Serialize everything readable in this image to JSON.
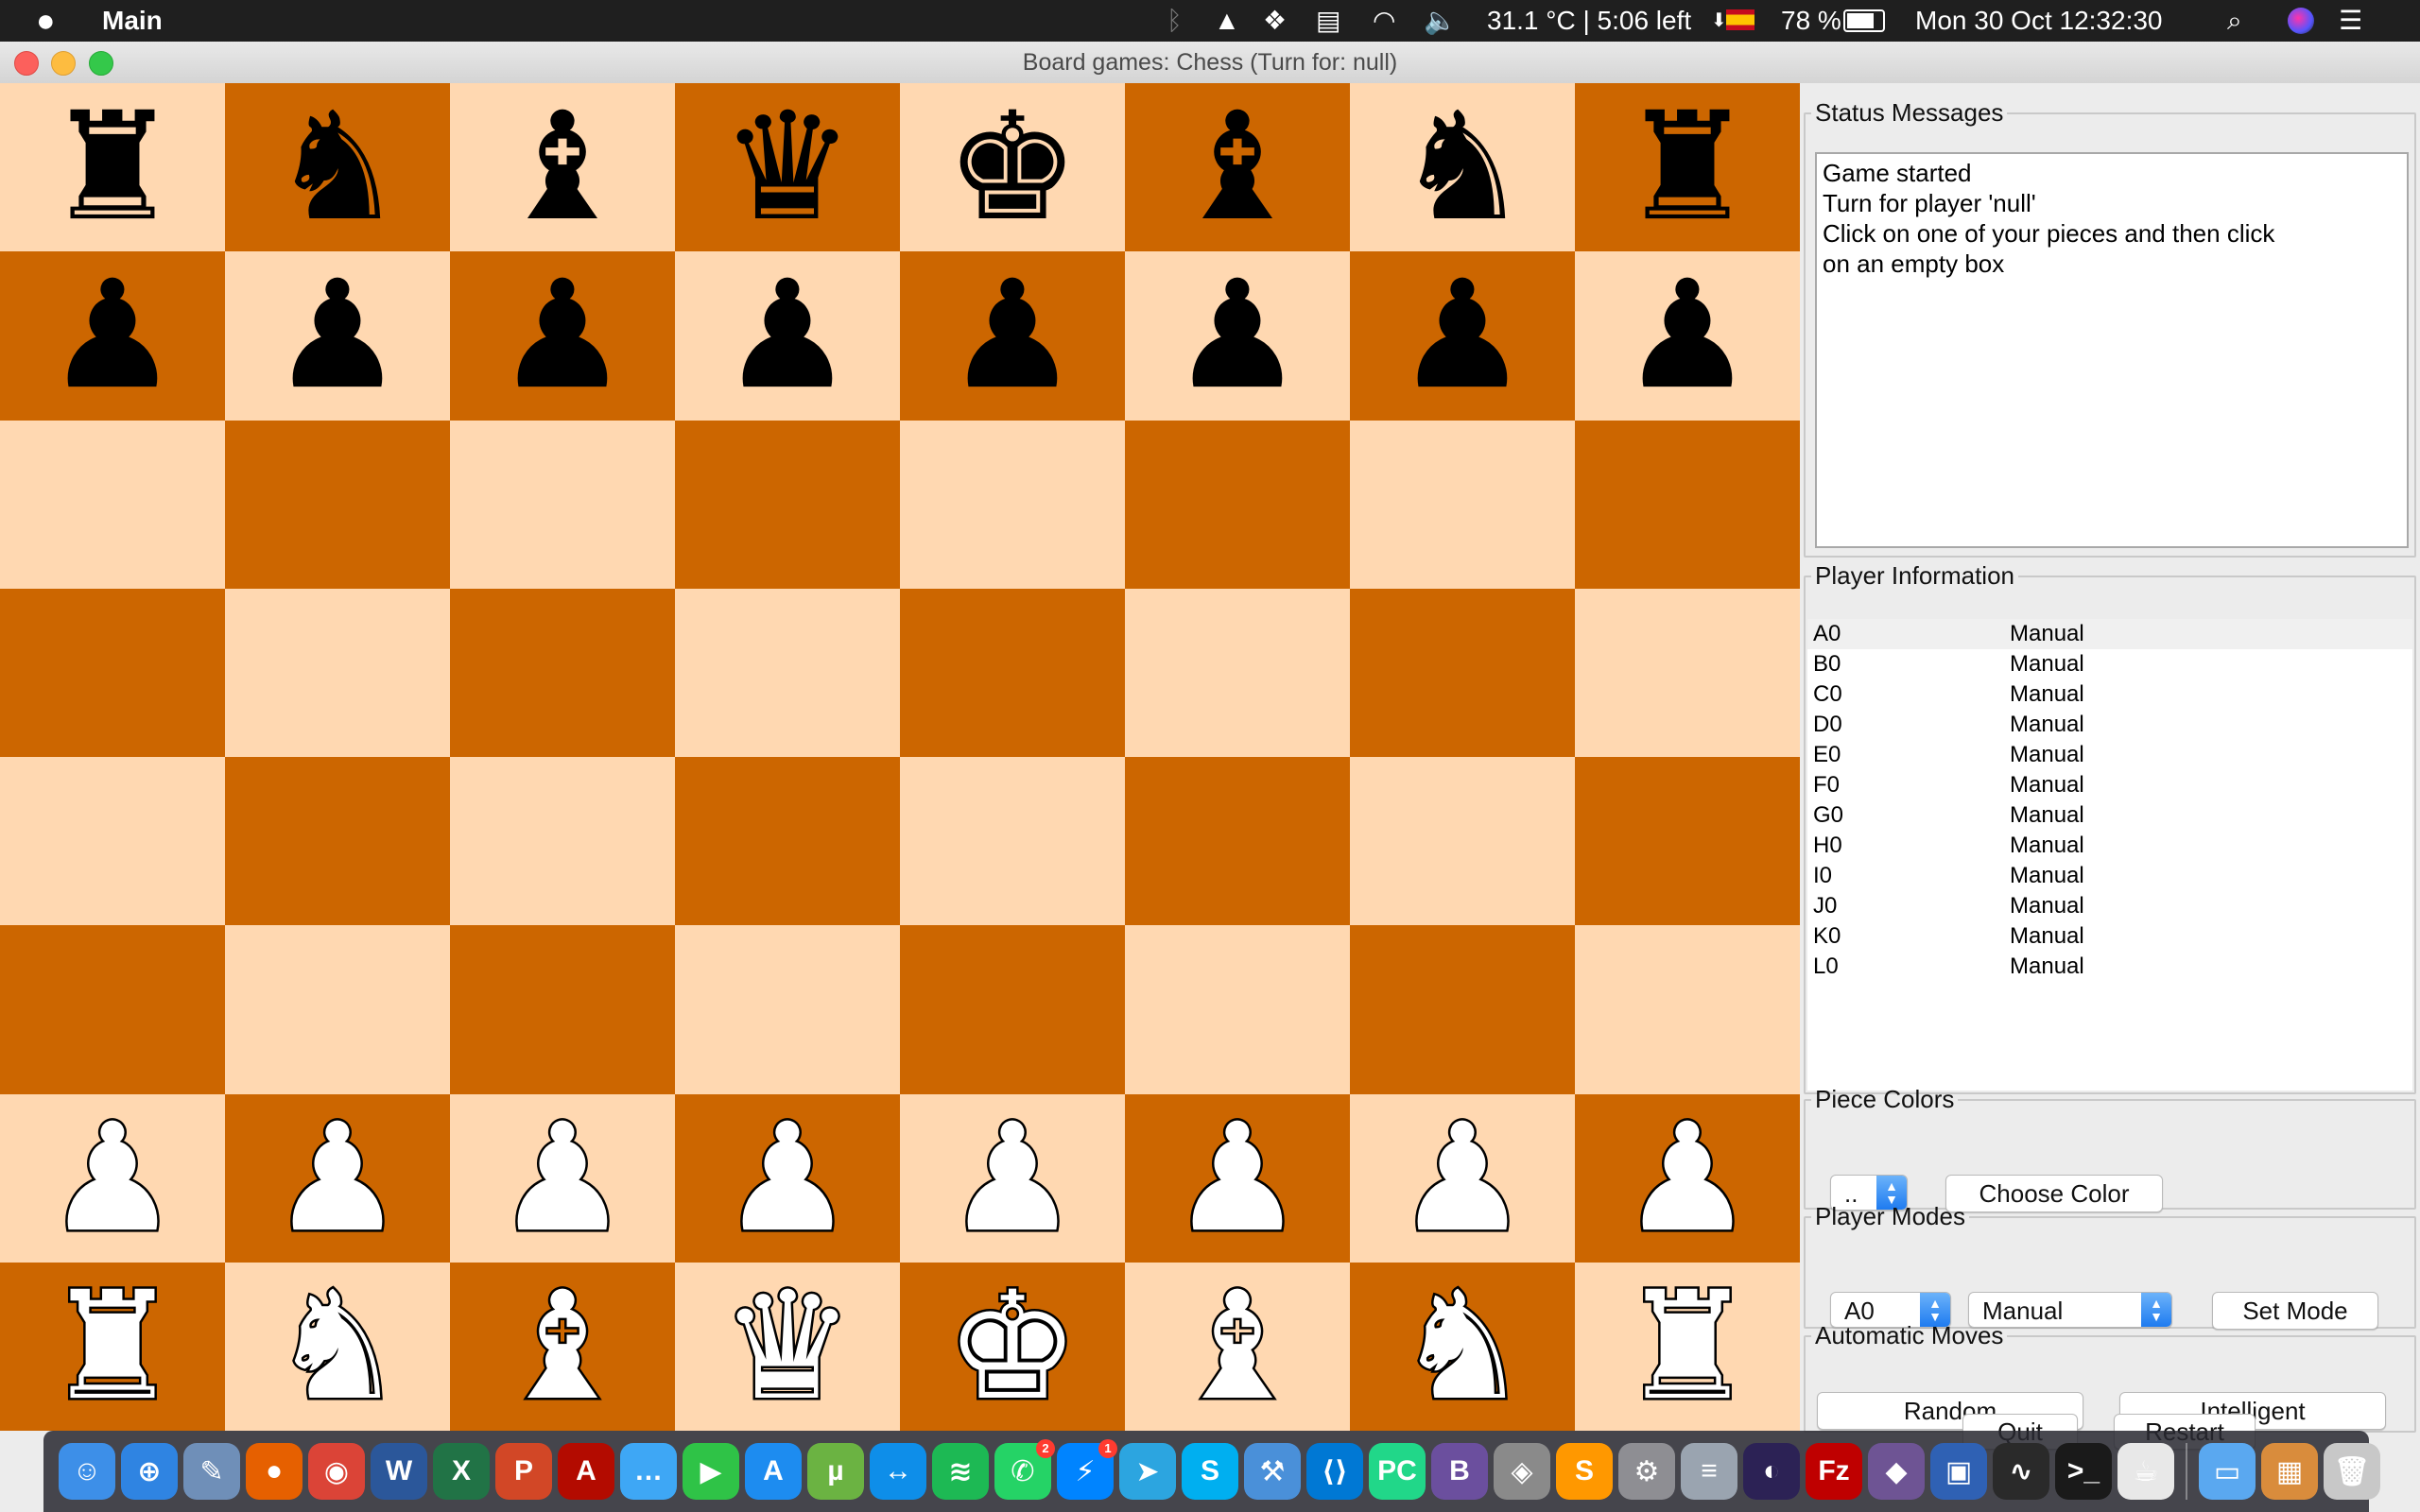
{
  "menubar": {
    "app_name": "Main",
    "temperature_battery": "31.1 °C | 5:06 left",
    "battery_percent": "78 %",
    "datetime": "Mon 30 Oct  12:32:30"
  },
  "window": {
    "title": "Board games: Chess (Turn for: null)"
  },
  "board": {
    "rows": [
      [
        "♜",
        "♞",
        "♝",
        "♛",
        "♚",
        "♝",
        "♞",
        "♜"
      ],
      [
        "♟",
        "♟",
        "♟",
        "♟",
        "♟",
        "♟",
        "♟",
        "♟"
      ],
      [
        "",
        "",
        "",
        "",
        "",
        "",
        "",
        ""
      ],
      [
        "",
        "",
        "",
        "",
        "",
        "",
        "",
        ""
      ],
      [
        "",
        "",
        "",
        "",
        "",
        "",
        "",
        ""
      ],
      [
        "",
        "",
        "",
        "",
        "",
        "",
        "",
        ""
      ],
      [
        "♟",
        "♟",
        "♟",
        "♟",
        "♟",
        "♟",
        "♟",
        "♟"
      ],
      [
        "♜",
        "♞",
        "♝",
        "♛",
        "♚",
        "♝",
        "♞",
        "♜"
      ]
    ],
    "piece_colors": [
      "black",
      "black",
      "empty",
      "empty",
      "empty",
      "empty",
      "white",
      "white"
    ],
    "light_color": "#ffd8b1",
    "dark_color": "#cc6600"
  },
  "status": {
    "legend": "Status Messages",
    "lines": [
      "Game started",
      "Turn for player 'null'",
      "Click on one of your pieces and then click",
      "on an empty box"
    ]
  },
  "players": {
    "legend": "Player Information",
    "rows": [
      {
        "id": "A0",
        "mode": "Manual"
      },
      {
        "id": "B0",
        "mode": "Manual"
      },
      {
        "id": "C0",
        "mode": "Manual"
      },
      {
        "id": "D0",
        "mode": "Manual"
      },
      {
        "id": "E0",
        "mode": "Manual"
      },
      {
        "id": "F0",
        "mode": "Manual"
      },
      {
        "id": "G0",
        "mode": "Manual"
      },
      {
        "id": "H0",
        "mode": "Manual"
      },
      {
        "id": "I0",
        "mode": "Manual"
      },
      {
        "id": "J0",
        "mode": "Manual"
      },
      {
        "id": "K0",
        "mode": "Manual"
      },
      {
        "id": "L0",
        "mode": "Manual"
      }
    ]
  },
  "piece_colors": {
    "legend": "Piece Colors",
    "selected": "..",
    "choose_button": "Choose Color"
  },
  "player_modes": {
    "legend": "Player Modes",
    "player_selected": "A0",
    "mode_selected": "Manual",
    "set_button": "Set Mode"
  },
  "automatic_moves": {
    "legend": "Automatic Moves",
    "random_button": "Random",
    "intelligent_button": "Intelligent"
  },
  "footer": {
    "quit_button": "Quit",
    "restart_button": "Restart"
  },
  "dock": {
    "items": [
      {
        "name": "finder-icon",
        "color": "#3d8fe8",
        "glyph": "☺"
      },
      {
        "name": "safari-icon",
        "color": "#2f84e2",
        "glyph": "⊕"
      },
      {
        "name": "preview-icon",
        "color": "#6f8fb8",
        "glyph": "✎"
      },
      {
        "name": "firefox-icon",
        "color": "#e66000",
        "glyph": "●"
      },
      {
        "name": "chrome-icon",
        "color": "#db4437",
        "glyph": "◉"
      },
      {
        "name": "word-icon",
        "color": "#2b579a",
        "glyph": "W"
      },
      {
        "name": "excel-icon",
        "color": "#217346",
        "glyph": "X"
      },
      {
        "name": "powerpoint-icon",
        "color": "#d24726",
        "glyph": "P"
      },
      {
        "name": "acrobat-icon",
        "color": "#b30b00",
        "glyph": "A"
      },
      {
        "name": "messages-icon",
        "color": "#3ea7f5",
        "glyph": "…"
      },
      {
        "name": "facetime-icon",
        "color": "#2fc347",
        "glyph": "▶"
      },
      {
        "name": "app-store-icon",
        "color": "#1d8cf0",
        "glyph": "A"
      },
      {
        "name": "utorrent-icon",
        "color": "#6bb342",
        "glyph": "µ"
      },
      {
        "name": "teamviewer-icon",
        "color": "#0e8ee9",
        "glyph": "↔"
      },
      {
        "name": "spotify-icon",
        "color": "#1db954",
        "glyph": "≋"
      },
      {
        "name": "whatsapp-icon",
        "color": "#25d366",
        "glyph": "✆",
        "badge": "2"
      },
      {
        "name": "messenger-icon",
        "color": "#0084ff",
        "glyph": "⚡",
        "badge": "1"
      },
      {
        "name": "telegram-icon",
        "color": "#2ca5e0",
        "glyph": "➤"
      },
      {
        "name": "skype-icon",
        "color": "#00aff0",
        "glyph": "S"
      },
      {
        "name": "xcode-icon",
        "color": "#4a90d9",
        "glyph": "⚒"
      },
      {
        "name": "vscode-icon",
        "color": "#0078d4",
        "glyph": "⟨⟩"
      },
      {
        "name": "pycharm-icon",
        "color": "#21d789",
        "glyph": "PC"
      },
      {
        "name": "bbedit-icon",
        "color": "#6b4f9e",
        "glyph": "B"
      },
      {
        "name": "eagle-icon",
        "color": "#8a8a8a",
        "glyph": "◈"
      },
      {
        "name": "sublime-icon",
        "color": "#ff9800",
        "glyph": "S"
      },
      {
        "name": "system-preferences-icon",
        "color": "#8e8e93",
        "glyph": "⚙"
      },
      {
        "name": "database-icon",
        "color": "#9aa4b0",
        "glyph": "≡"
      },
      {
        "name": "eclipse-icon",
        "color": "#2c2255",
        "glyph": "◐"
      },
      {
        "name": "filezilla-icon",
        "color": "#bf0000",
        "glyph": "Fz"
      },
      {
        "name": "github-icon",
        "color": "#6e5494",
        "glyph": "◆"
      },
      {
        "name": "virtualbox-icon",
        "color": "#2f61b4",
        "glyph": "▣"
      },
      {
        "name": "activity-monitor-icon",
        "color": "#2a2a2a",
        "glyph": "∿"
      },
      {
        "name": "terminal-icon",
        "color": "#1a1a1a",
        "glyph": ">_"
      },
      {
        "name": "java-icon",
        "color": "#e8e8e8",
        "glyph": "☕"
      },
      {
        "name": "separator",
        "color": "",
        "glyph": ""
      },
      {
        "name": "folder-icon",
        "color": "#5aa8f0",
        "glyph": "▭"
      },
      {
        "name": "chess-board-icon",
        "color": "#d98c3c",
        "glyph": "▦"
      },
      {
        "name": "trash-icon",
        "color": "#c8c8c8",
        "glyph": "🗑"
      }
    ]
  }
}
